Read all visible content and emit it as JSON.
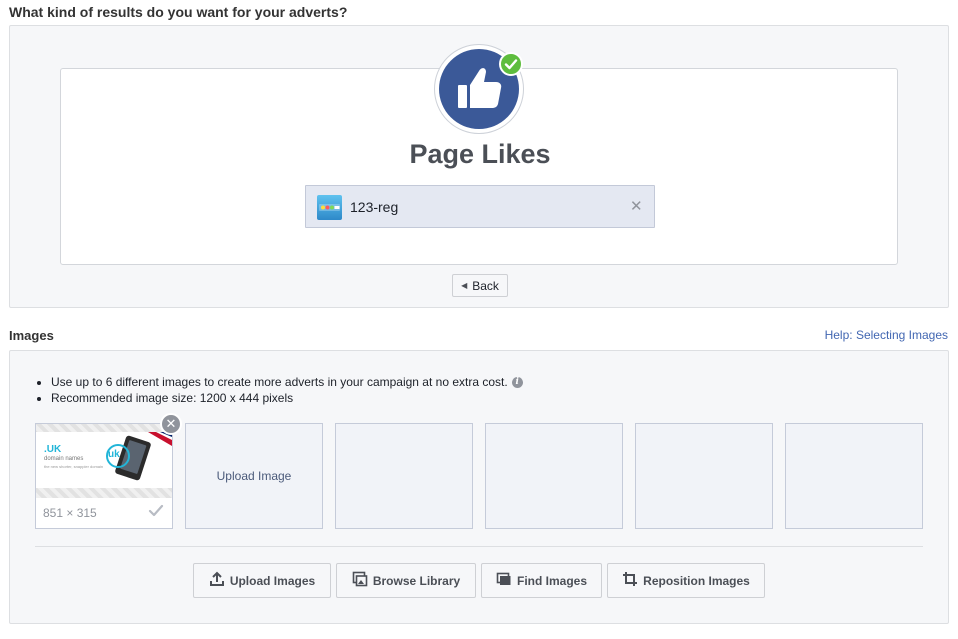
{
  "objective": {
    "question": "What kind of results do you want for your adverts?",
    "title": "Page Likes",
    "selected_page": {
      "name": "123-reg",
      "thumb_text": "123 reg"
    },
    "remove_icon": "close-icon",
    "back_label": "Back"
  },
  "images": {
    "heading": "Images",
    "help_link": "Help: Selecting Images",
    "bullets": [
      "Use up to 6 different images to create more adverts in your campaign at no extra cost.",
      "Recommended image size: 1200 x 444 pixels"
    ],
    "info_icon_glyph": "i",
    "uploaded": {
      "dimensions": "851 × 315",
      "banner_logo": ".UK",
      "banner_line1": "domain names",
      "banner_line2": "the new shorter, snappier domain",
      "badge": "uk"
    },
    "upload_slot_label": "Upload Image",
    "actions": {
      "upload": "Upload Images",
      "browse": "Browse Library",
      "find": "Find Images",
      "reposition": "Reposition Images"
    }
  },
  "colors": {
    "brand": "#3b5998",
    "success": "#5ebd3e",
    "link": "#4267b2"
  }
}
